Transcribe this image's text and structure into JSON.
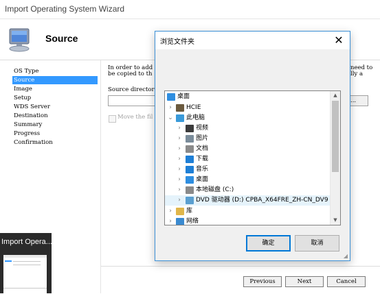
{
  "wizard": {
    "title": "Import Operating System Wizard",
    "page_title": "Source",
    "steps": [
      "OS Type",
      "Source",
      "Image",
      "Setup",
      "WDS Server",
      "Destination",
      "Summary",
      "Progress",
      "Confirmation"
    ],
    "active_step": "Source",
    "intro_line1": "In order to add",
    "intro_line2": "be copied to th",
    "intro_right1": "need to",
    "intro_right2": "lly a",
    "source_label": "Source director",
    "source_value": "",
    "browse_label": "e...",
    "move_files_label": "Move the fil",
    "buttons": {
      "previous": "Previous",
      "next": "Next",
      "cancel": "Cancel"
    }
  },
  "taskbar_thumb": {
    "title": "Import Opera..."
  },
  "browse_dialog": {
    "title": "浏览文件夹",
    "close_glyph": "✕",
    "tree": [
      {
        "label": "桌面",
        "icon": "desktop-icon",
        "color": "#2f8ee0"
      },
      {
        "label": "HCIE",
        "icon": "user-icon",
        "color": "#6b5a3e"
      },
      {
        "label": "此电脑",
        "icon": "computer-icon",
        "color": "#3a9ad9"
      },
      {
        "label": "视频",
        "icon": "video-icon",
        "color": "#3b3b3b"
      },
      {
        "label": "图片",
        "icon": "pictures-icon",
        "color": "#7a8c9a"
      },
      {
        "label": "文档",
        "icon": "documents-icon",
        "color": "#8a8a8a"
      },
      {
        "label": "下载",
        "icon": "download-icon",
        "color": "#1e7fd6"
      },
      {
        "label": "音乐",
        "icon": "music-icon",
        "color": "#1e7fd6"
      },
      {
        "label": "桌面",
        "icon": "desktop-icon",
        "color": "#2f8ee0"
      },
      {
        "label": "本地磁盘 (C:)",
        "icon": "drive-icon",
        "color": "#8a8a8a"
      },
      {
        "label": "DVD 驱动器 (D:) CPBA_X64FRE_ZH-CN_DV9",
        "icon": "dvd-icon",
        "color": "#5a9fd0"
      },
      {
        "label": "库",
        "icon": "library-icon",
        "color": "#e0b64a"
      },
      {
        "label": "网络",
        "icon": "network-icon",
        "color": "#3a8ad0"
      }
    ],
    "buttons": {
      "ok": "确定",
      "cancel": "取消"
    }
  }
}
